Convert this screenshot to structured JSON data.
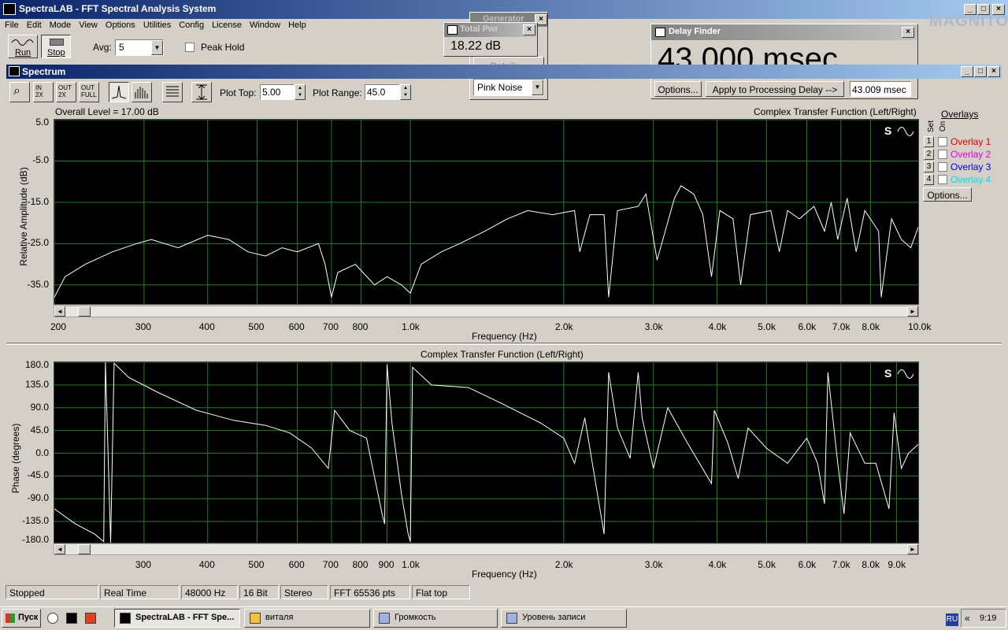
{
  "app": {
    "title": "SpectraLAB - FFT Spectral Analysis System",
    "watermark": "MAGNITOLA"
  },
  "menu": [
    "File",
    "Edit",
    "Mode",
    "View",
    "Options",
    "Utilities",
    "Config",
    "License",
    "Window",
    "Help"
  ],
  "toolbar": {
    "run_label": "Run",
    "stop_label": "Stop",
    "avg_label": "Avg:",
    "avg_value": "5",
    "peak_hold_label": "Peak Hold"
  },
  "total_pwr": {
    "title": "Total Pwr",
    "value": "18.22 dB",
    "behind_title": "Generator",
    "details_label": "Details...",
    "signal_select": "Pink Noise"
  },
  "delay_finder": {
    "title": "Delay Finder",
    "value": "43.000 msec",
    "options_label": "Options...",
    "apply_label": "Apply to Processing Delay -->",
    "field_value": "43.009 msec"
  },
  "spectrum": {
    "title": "Spectrum",
    "plot_top_label": "Plot Top:",
    "plot_top_value": "5.00",
    "plot_range_label": "Plot Range:",
    "plot_range_value": "45.0"
  },
  "icons": {
    "zoom": "magnifier-icon",
    "zoom_in": "zoom-in-2x-icon",
    "zoom_out": "zoom-out-2x-icon",
    "zoom_full": "zoom-out-full-icon",
    "line": "line-mode-icon",
    "bars": "bar-mode-icon",
    "list": "list-icon",
    "vscale": "vertical-scale-icon"
  },
  "overlays": {
    "header": "Overlays",
    "set_label": "Set",
    "on_label": "On",
    "items": [
      {
        "num": "1",
        "label": "Overlay 1",
        "color": "#e00000"
      },
      {
        "num": "2",
        "label": "Overlay 2",
        "color": "#e000e0"
      },
      {
        "num": "3",
        "label": "Overlay 3",
        "color": "#0000e0"
      },
      {
        "num": "4",
        "label": "Overlay 4",
        "color": "#00e0e0"
      }
    ],
    "options_label": "Options..."
  },
  "chart_data": [
    {
      "type": "line",
      "title": "Complex Transfer Function (Left/Right)",
      "overall_level": "Overall Level = 17.00 dB",
      "xlabel": "Frequency (Hz)",
      "ylabel": "Relative Amplitude (dB)",
      "x_scale": "log",
      "xlim": [
        200,
        10000
      ],
      "ylim": [
        -40,
        5
      ],
      "x_ticks": [
        {
          "v": 200,
          "t": "200"
        },
        {
          "v": 300,
          "t": "300"
        },
        {
          "v": 400,
          "t": "400"
        },
        {
          "v": 500,
          "t": "500"
        },
        {
          "v": 600,
          "t": "600"
        },
        {
          "v": 700,
          "t": "700"
        },
        {
          "v": 800,
          "t": "800"
        },
        {
          "v": 1000,
          "t": "1.0k"
        },
        {
          "v": 2000,
          "t": "2.0k"
        },
        {
          "v": 3000,
          "t": "3.0k"
        },
        {
          "v": 4000,
          "t": "4.0k"
        },
        {
          "v": 5000,
          "t": "5.0k"
        },
        {
          "v": 6000,
          "t": "6.0k"
        },
        {
          "v": 7000,
          "t": "7.0k"
        },
        {
          "v": 8000,
          "t": "8.0k"
        },
        {
          "v": 10000,
          "t": "10.0k"
        }
      ],
      "y_ticks": [
        {
          "v": 5,
          "t": "5.0"
        },
        {
          "v": -5,
          "t": "-5.0"
        },
        {
          "v": -15,
          "t": "-15.0"
        },
        {
          "v": -25,
          "t": "-25.0"
        },
        {
          "v": -35,
          "t": "-35.0"
        }
      ],
      "grid": true,
      "series": [
        {
          "color": "#ffffff",
          "points": [
            [
              200,
              -38
            ],
            [
              210,
              -33
            ],
            [
              230,
              -30
            ],
            [
              260,
              -27
            ],
            [
              290,
              -25
            ],
            [
              310,
              -24
            ],
            [
              350,
              -26
            ],
            [
              400,
              -23
            ],
            [
              440,
              -24
            ],
            [
              480,
              -27
            ],
            [
              520,
              -28
            ],
            [
              560,
              -26
            ],
            [
              600,
              -27
            ],
            [
              660,
              -25
            ],
            [
              680,
              -30
            ],
            [
              700,
              -38
            ],
            [
              720,
              -32
            ],
            [
              780,
              -30
            ],
            [
              850,
              -35
            ],
            [
              900,
              -33
            ],
            [
              960,
              -35
            ],
            [
              1000,
              -37
            ],
            [
              1050,
              -30
            ],
            [
              1150,
              -27
            ],
            [
              1250,
              -25
            ],
            [
              1400,
              -22
            ],
            [
              1550,
              -19
            ],
            [
              1700,
              -17
            ],
            [
              1900,
              -18
            ],
            [
              2100,
              -17
            ],
            [
              2150,
              -27
            ],
            [
              2250,
              -18
            ],
            [
              2400,
              -18
            ],
            [
              2450,
              -38
            ],
            [
              2550,
              -17
            ],
            [
              2800,
              -16
            ],
            [
              2900,
              -13
            ],
            [
              3050,
              -29
            ],
            [
              3300,
              -14
            ],
            [
              3400,
              -11
            ],
            [
              3600,
              -13
            ],
            [
              3750,
              -18
            ],
            [
              3900,
              -33
            ],
            [
              4050,
              -17
            ],
            [
              4300,
              -19
            ],
            [
              4450,
              -35
            ],
            [
              4650,
              -18
            ],
            [
              5100,
              -17
            ],
            [
              5300,
              -27
            ],
            [
              5500,
              -17
            ],
            [
              5800,
              -19
            ],
            [
              6200,
              -16
            ],
            [
              6500,
              -22
            ],
            [
              6700,
              -15
            ],
            [
              6900,
              -24
            ],
            [
              7200,
              -14
            ],
            [
              7500,
              -27
            ],
            [
              7800,
              -17
            ],
            [
              8300,
              -22
            ],
            [
              8400,
              -38
            ],
            [
              8800,
              -19
            ],
            [
              9200,
              -24
            ],
            [
              9600,
              -26
            ],
            [
              10000,
              -20
            ]
          ]
        }
      ]
    },
    {
      "type": "line",
      "title": "Complex Transfer Function (Left/Right)",
      "xlabel": "Frequency (Hz)",
      "ylabel": "Phase (degrees)",
      "x_scale": "log",
      "xlim": [
        200,
        10000
      ],
      "ylim": [
        -180,
        180
      ],
      "x_ticks": [
        {
          "v": 300,
          "t": "300"
        },
        {
          "v": 400,
          "t": "400"
        },
        {
          "v": 500,
          "t": "500"
        },
        {
          "v": 600,
          "t": "600"
        },
        {
          "v": 700,
          "t": "700"
        },
        {
          "v": 800,
          "t": "800"
        },
        {
          "v": 900,
          "t": "900"
        },
        {
          "v": 1000,
          "t": "1.0k"
        },
        {
          "v": 2000,
          "t": "2.0k"
        },
        {
          "v": 3000,
          "t": "3.0k"
        },
        {
          "v": 4000,
          "t": "4.0k"
        },
        {
          "v": 5000,
          "t": "5.0k"
        },
        {
          "v": 6000,
          "t": "6.0k"
        },
        {
          "v": 7000,
          "t": "7.0k"
        },
        {
          "v": 8000,
          "t": "8.0k"
        },
        {
          "v": 9000,
          "t": "9.0k"
        }
      ],
      "y_ticks": [
        {
          "v": 180,
          "t": "180.0"
        },
        {
          "v": 135,
          "t": "135.0"
        },
        {
          "v": 90,
          "t": "90.0"
        },
        {
          "v": 45,
          "t": "45.0"
        },
        {
          "v": 0,
          "t": "0.0"
        },
        {
          "v": -45,
          "t": "-45.0"
        },
        {
          "v": -90,
          "t": "-90.0"
        },
        {
          "v": -135,
          "t": "-135.0"
        },
        {
          "v": -180,
          "t": "-180.0"
        }
      ],
      "grid": true,
      "series": [
        {
          "color": "#ffffff",
          "points": [
            [
              200,
              -110
            ],
            [
              220,
              -140
            ],
            [
              240,
              -160
            ],
            [
              250,
              -175
            ],
            [
              252,
              180
            ],
            [
              258,
              -178
            ],
            [
              262,
              178
            ],
            [
              280,
              150
            ],
            [
              320,
              120
            ],
            [
              380,
              85
            ],
            [
              450,
              65
            ],
            [
              520,
              55
            ],
            [
              580,
              40
            ],
            [
              640,
              10
            ],
            [
              690,
              -30
            ],
            [
              710,
              85
            ],
            [
              760,
              45
            ],
            [
              820,
              30
            ],
            [
              880,
              -120
            ],
            [
              890,
              -140
            ],
            [
              900,
              175
            ],
            [
              920,
              60
            ],
            [
              960,
              -80
            ],
            [
              990,
              -160
            ],
            [
              1000,
              -175
            ],
            [
              1010,
              170
            ],
            [
              1100,
              135
            ],
            [
              1300,
              130
            ],
            [
              1500,
              100
            ],
            [
              1800,
              60
            ],
            [
              2000,
              30
            ],
            [
              2100,
              -20
            ],
            [
              2200,
              70
            ],
            [
              2400,
              -160
            ],
            [
              2450,
              160
            ],
            [
              2550,
              50
            ],
            [
              2700,
              -10
            ],
            [
              2800,
              160
            ],
            [
              2850,
              70
            ],
            [
              3000,
              -30
            ],
            [
              3200,
              90
            ],
            [
              3500,
              20
            ],
            [
              3900,
              -60
            ],
            [
              3950,
              85
            ],
            [
              4200,
              20
            ],
            [
              4400,
              -50
            ],
            [
              4600,
              50
            ],
            [
              5000,
              10
            ],
            [
              5500,
              -20
            ],
            [
              6000,
              30
            ],
            [
              6300,
              -20
            ],
            [
              6500,
              -100
            ],
            [
              6600,
              160
            ],
            [
              6900,
              -20
            ],
            [
              7100,
              -120
            ],
            [
              7300,
              40
            ],
            [
              7800,
              -20
            ],
            [
              8200,
              -20
            ],
            [
              8700,
              -110
            ],
            [
              8900,
              80
            ],
            [
              9200,
              -30
            ],
            [
              9500,
              0
            ],
            [
              10000,
              20
            ]
          ]
        }
      ]
    }
  ],
  "status": [
    "Stopped",
    "Real Time",
    "48000 Hz",
    "16 Bit",
    "Stereo",
    "FFT 65536 pts",
    "Flat top"
  ],
  "taskbar": {
    "start_label": "Пуск",
    "tasks": [
      "SpectraLAB - FFT Spe...",
      "виталя",
      "Громкость",
      "Уровень записи"
    ],
    "lang": "RU",
    "clock": "9:19"
  }
}
